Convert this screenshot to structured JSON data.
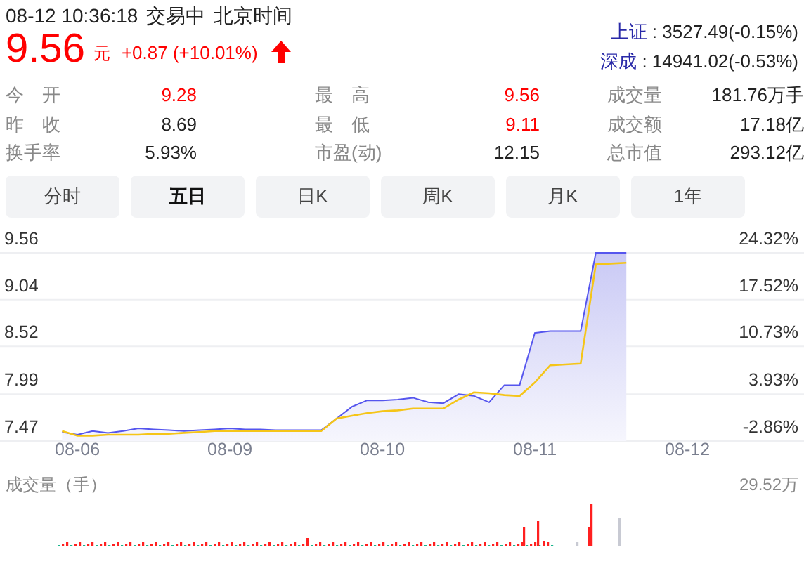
{
  "header": {
    "datetime": "08-12 10:36:18",
    "status": "交易中",
    "timezone": "北京时间"
  },
  "quote": {
    "price": "9.56",
    "unit": "元",
    "change": "+0.87 (+10.01%)",
    "up": true
  },
  "indices": [
    {
      "name": "上证",
      "value": ": 3527.49(-0.15%)"
    },
    {
      "name": "深成",
      "value": ": 14941.02(-0.53%)"
    }
  ],
  "stats": [
    {
      "label": "今　开",
      "value": "9.28",
      "color": "#ff0000"
    },
    {
      "label": "最　高",
      "value": "9.56",
      "color": "#ff0000"
    },
    {
      "label": "成交量",
      "value": "181.76万手",
      "color": "#222222"
    },
    {
      "label": "昨　收",
      "value": "8.69",
      "color": "#222222"
    },
    {
      "label": "最　低",
      "value": "9.11",
      "color": "#ff0000"
    },
    {
      "label": "成交额",
      "value": "17.18亿",
      "color": "#222222"
    },
    {
      "label": "换手率",
      "value": "5.93%",
      "color": "#222222"
    },
    {
      "label": "市盈(动)",
      "value": "12.15",
      "color": "#222222"
    },
    {
      "label": "总市值",
      "value": "293.12亿",
      "color": "#222222"
    }
  ],
  "tabs": [
    {
      "label": "分时",
      "selected": false
    },
    {
      "label": "五日",
      "selected": true
    },
    {
      "label": "日K",
      "selected": false
    },
    {
      "label": "周K",
      "selected": false
    },
    {
      "label": "月K",
      "selected": false
    },
    {
      "label": "1年",
      "selected": false
    }
  ],
  "price_chart": {
    "percent_labels": [
      "24.32%",
      "17.52%",
      "10.73%",
      "3.93%",
      "-2.86%"
    ],
    "chart_data": {
      "type": "area",
      "grid": true,
      "categories": [
        null,
        "08-06",
        null,
        null,
        null,
        null,
        null,
        null,
        null,
        null,
        null,
        "08-09",
        null,
        null,
        null,
        null,
        null,
        null,
        null,
        null,
        null,
        "08-10",
        null,
        null,
        null,
        null,
        null,
        null,
        null,
        null,
        null,
        "08-11",
        null,
        null,
        null,
        null,
        null,
        null,
        null,
        null,
        null,
        "08-12",
        null,
        null,
        null,
        null,
        null,
        null,
        null
      ],
      "series": [
        {
          "type": "area",
          "color": "#5555ee",
          "values": [
            7.57,
            7.54,
            7.58,
            7.56,
            7.58,
            7.61,
            7.6,
            7.59,
            7.58,
            7.59,
            7.6,
            7.61,
            7.6,
            7.6,
            7.59,
            7.59,
            7.59,
            7.59,
            7.72,
            7.85,
            7.92,
            7.92,
            7.93,
            7.95,
            7.9,
            7.89,
            7.99,
            7.97,
            7.9,
            8.09,
            8.09,
            8.67,
            8.69,
            8.69,
            8.69,
            9.56,
            9.56,
            9.56,
            null,
            null,
            null,
            null,
            null,
            null,
            null,
            null,
            null,
            null,
            null
          ]
        },
        {
          "type": "line",
          "color": "#f5c518",
          "values": [
            7.58,
            7.53,
            7.53,
            7.54,
            7.54,
            7.54,
            7.55,
            7.55,
            7.56,
            7.57,
            7.58,
            7.58,
            7.58,
            7.58,
            7.58,
            7.58,
            7.58,
            7.58,
            7.72,
            7.75,
            7.78,
            7.8,
            7.81,
            7.83,
            7.83,
            7.83,
            7.93,
            8.01,
            8.0,
            7.98,
            7.97,
            8.12,
            8.31,
            8.32,
            8.33,
            9.43,
            9.44,
            9.45,
            null,
            null,
            null,
            null,
            null,
            null,
            null,
            null,
            null,
            null,
            null
          ]
        }
      ],
      "ylim": [
        7.47,
        9.56
      ],
      "yticks": [
        {
          "value": 9.56,
          "label": "9.56"
        },
        {
          "value": 9.04,
          "label": "9.04"
        },
        {
          "value": 8.52,
          "label": "8.52"
        },
        {
          "value": 7.99,
          "label": "7.99"
        },
        {
          "value": 7.47,
          "label": "7.47"
        }
      ]
    }
  },
  "volume_chart": {
    "title": "成交量（手）",
    "max_label": "29.52万"
  }
}
